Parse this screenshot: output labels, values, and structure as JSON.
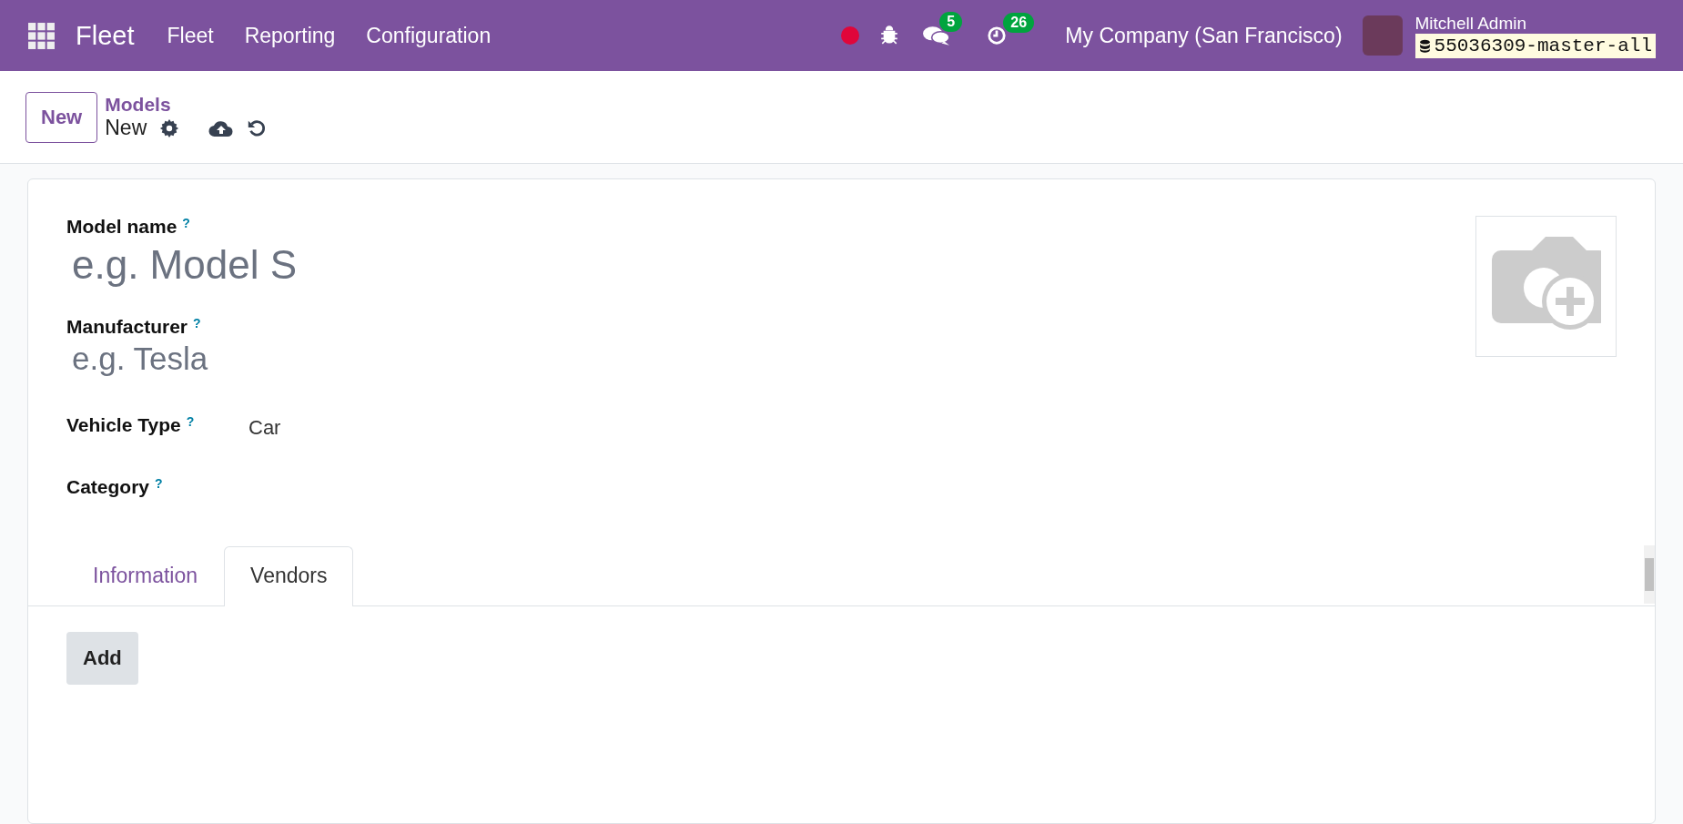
{
  "navbar": {
    "app_name": "Fleet",
    "menu": [
      "Fleet",
      "Reporting",
      "Configuration"
    ],
    "recording": true,
    "messages_count": "5",
    "activities_count": "26",
    "company": "My Company (San Francisco)",
    "user_name": "Mitchell Admin",
    "database": "55036309-master-all"
  },
  "control_panel": {
    "new_button": "New",
    "breadcrumb": "Models",
    "record_title": "New"
  },
  "form": {
    "fields": [
      {
        "kind": "title",
        "label": "Model name",
        "help": "?",
        "placeholder": "e.g. Model S"
      },
      {
        "kind": "subtitle",
        "label": "Manufacturer",
        "help": "?",
        "placeholder": "e.g. Tesla"
      },
      {
        "kind": "inline",
        "label": "Vehicle Type",
        "help": "?",
        "value": "Car"
      },
      {
        "kind": "inline",
        "label": "Category",
        "help": "?"
      }
    ],
    "tabs": [
      {
        "label": "Information",
        "selected": false
      },
      {
        "label": "Vendors",
        "selected": true
      }
    ],
    "add_button": "Add"
  }
}
